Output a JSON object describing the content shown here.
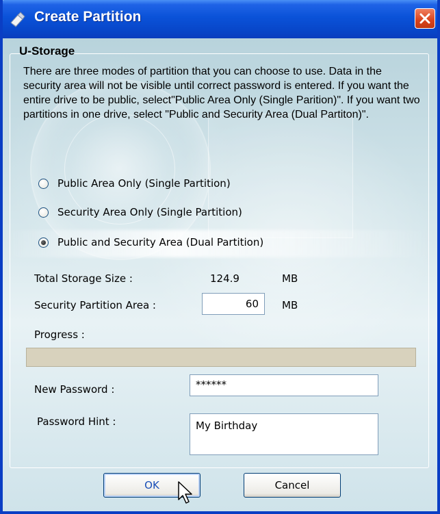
{
  "window": {
    "title": "Create Partition"
  },
  "group": {
    "title": "U-Storage",
    "description": "There are three modes of partition that you can choose to use. Data in the security area will not be visible until correct password is entered. If you want the entire drive to be public, select\"Public Area Only (Single Parition)\". If you want two partitions in one drive, select \"Public and Security Area (Dual Partiton)\"."
  },
  "modes": [
    {
      "label": "Public Area Only (Single Partition)",
      "checked": false
    },
    {
      "label": "Security Area Only (Single Partition)",
      "checked": false
    },
    {
      "label": "Public and Security Area (Dual Partition)",
      "checked": true
    }
  ],
  "storage": {
    "total_label": "Total Storage Size :",
    "total_value": "124.9",
    "total_unit": "MB",
    "security_label": "Security Partition Area :",
    "security_value": "60",
    "security_unit": "MB"
  },
  "progress": {
    "label": "Progress :",
    "value": 0
  },
  "password": {
    "label": "New Password :",
    "value": "******"
  },
  "hint": {
    "label": "Password Hint :",
    "value": "My Birthday"
  },
  "buttons": {
    "ok": "OK",
    "cancel": "Cancel"
  },
  "colors": {
    "titlebar": "#0a52d8",
    "close": "#d9421c",
    "progress_track": "#d8d2bd"
  },
  "icons": {
    "title": "usb-drive-icon",
    "close": "close-icon",
    "cursor": "mouse-pointer-icon"
  }
}
